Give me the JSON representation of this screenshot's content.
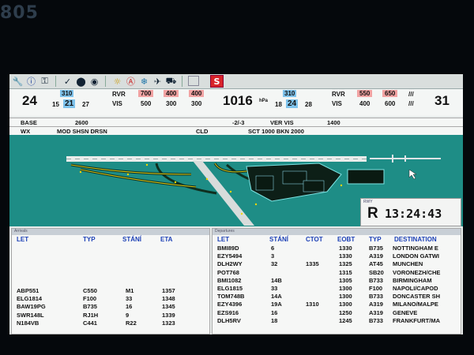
{
  "bezel_label": "805",
  "toolbar": {
    "icons": [
      "wrench-icon",
      "info-icon",
      "key-icon",
      "check-icon",
      "record-icon",
      "toggle-icon",
      "sun-icon",
      "alert-icon",
      "snow-icon",
      "plane-icon",
      "plane-ground-icon",
      "blank-icon",
      "stop-icon"
    ],
    "stop_label": "S"
  },
  "weather": {
    "runway_left": "24",
    "wind_left": {
      "dir": "310",
      "min": "15",
      "spd": "21",
      "max": "27"
    },
    "rvr_label": "RVR",
    "vis_label": "VIS",
    "rvr_left": [
      "700",
      "400",
      "400"
    ],
    "vis_left": [
      "500",
      "300",
      "300"
    ],
    "qnh": "1016",
    "qnh_unit": "hPa",
    "wind_right": {
      "dir": "310",
      "min": "18",
      "spd": "24",
      "max": "28"
    },
    "rvr_right": [
      "550",
      "650"
    ],
    "vis_right": [
      "400",
      "600"
    ],
    "runway_right": "31",
    "slashes": "///",
    "base_label": "BASE",
    "base_value": "2600",
    "temp": "-2/-3",
    "ver_vis_label": "VER VIS",
    "ver_vis_value": "1400",
    "wx_label": "WX",
    "wx_value": "MOD SHSN  DRSN",
    "cld_label": "CLD",
    "cld_value": "SCT 1000  BKN 2000"
  },
  "clock": {
    "label": "RWY",
    "runway_state": "R",
    "time": "13:24:43"
  },
  "arrivals": {
    "title": "Arrivals",
    "headers": {
      "let": "LET",
      "typ": "TYP",
      "stani": "STÁNÍ",
      "eta": "ETA"
    },
    "rows": [
      {
        "let": "ABP551",
        "typ": "C550",
        "stani": "M1",
        "eta": "1357"
      },
      {
        "let": "ELG1814",
        "typ": "F100",
        "stani": "33",
        "eta": "1348"
      },
      {
        "let": "BAW19PG",
        "typ": "B735",
        "stani": "16",
        "eta": "1345"
      },
      {
        "let": "SWR148L",
        "typ": "RJ1H",
        "stani": "9",
        "eta": "1339"
      },
      {
        "let": "N184VB",
        "typ": "C441",
        "stani": "R22",
        "eta": "1323"
      }
    ]
  },
  "departures": {
    "title": "Departures",
    "headers": {
      "let": "LET",
      "stani": "STÁNÍ",
      "ctot": "CTOT",
      "eobt": "EOBT",
      "typ": "TYP",
      "dest": "DESTINATION"
    },
    "rows": [
      {
        "let": "BMI89D",
        "stani": "6",
        "ctot": "",
        "eobt": "1330",
        "typ": "B735",
        "dest": "NOTTINGHAM E"
      },
      {
        "let": "EZY5494",
        "stani": "3",
        "ctot": "",
        "eobt": "1330",
        "typ": "A319",
        "dest": "LONDON GATWI"
      },
      {
        "let": "DLH2WY",
        "stani": "32",
        "ctot": "1335",
        "eobt": "1325",
        "typ": "AT45",
        "dest": "MUNCHEN"
      },
      {
        "let": "POT768",
        "stani": "",
        "ctot": "",
        "eobt": "1315",
        "typ": "SB20",
        "dest": "VORONEZH/CHE"
      },
      {
        "let": "BMI1082",
        "stani": "14B",
        "ctot": "",
        "eobt": "1305",
        "typ": "B733",
        "dest": "BIRMINGHAM"
      },
      {
        "let": "ELG1815",
        "stani": "33",
        "ctot": "",
        "eobt": "1300",
        "typ": "F100",
        "dest": "NAPOLI/CAPOD"
      },
      {
        "let": "TOM748B",
        "stani": "14A",
        "ctot": "",
        "eobt": "1300",
        "typ": "B733",
        "dest": "DONCASTER SH"
      },
      {
        "let": "EZY4396",
        "stani": "19A",
        "ctot": "1310",
        "eobt": "1300",
        "typ": "A319",
        "dest": "MILANO/MALPE"
      },
      {
        "let": "EZS916",
        "stani": "16",
        "ctot": "",
        "eobt": "1250",
        "typ": "A319",
        "dest": "GENEVE"
      },
      {
        "let": "DLH5RV",
        "stani": "18",
        "ctot": "",
        "eobt": "1245",
        "typ": "B733",
        "dest": "FRANKFURT/MA"
      }
    ]
  }
}
